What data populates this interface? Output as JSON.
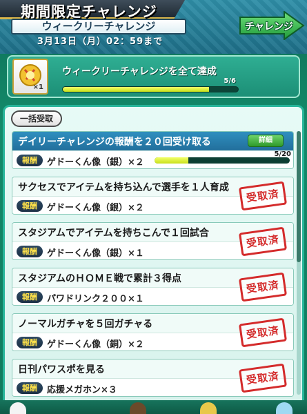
{
  "header": {
    "title": "期間限定チャレンジ",
    "subtitle": "ウィークリーチャレンジ",
    "deadline": "3月13日（月）02：59まで",
    "challenge_button": "チャレンジ"
  },
  "weekly": {
    "label": "ウィークリーチャレンジを全て達成",
    "progress_text": "5/6",
    "progress_fraction": 0.833,
    "trophy_count": "×1",
    "trophy_icon": "gold-trophy-icon"
  },
  "bulk_button": "一括受取",
  "reward_label": "報酬",
  "missions": [
    {
      "title": "デイリーチャレンジの報酬を２０回受け取る",
      "reward": "ゲドーくん像（銀）×２",
      "detail_label": "詳細",
      "progress_text": "5/20",
      "progress_fraction": 0.25,
      "status": "active"
    },
    {
      "title": "サクセスでアイテムを持ち込んで選手を１人育成",
      "reward": "ゲドーくん像（銀）×２",
      "stamp": "受取済",
      "status": "claimed"
    },
    {
      "title": "スタジアムでアイテムを持ちこんで１回試合",
      "reward": "ゲドーくん像（銀）×１",
      "stamp": "受取済",
      "status": "claimed"
    },
    {
      "title": "スタジアムのＨＯＭＥ戦で累計３得点",
      "reward": "パワドリンク２００×１",
      "stamp": "受取済",
      "status": "claimed"
    },
    {
      "title": "ノーマルガチャを５回ガチャる",
      "reward": "ゲドーくん像（銅）×２",
      "stamp": "受取済",
      "status": "claimed"
    },
    {
      "title": "日刊パワスポを見る",
      "reward": "応援メガホン×３",
      "stamp": "受取済",
      "status": "claimed"
    }
  ]
}
